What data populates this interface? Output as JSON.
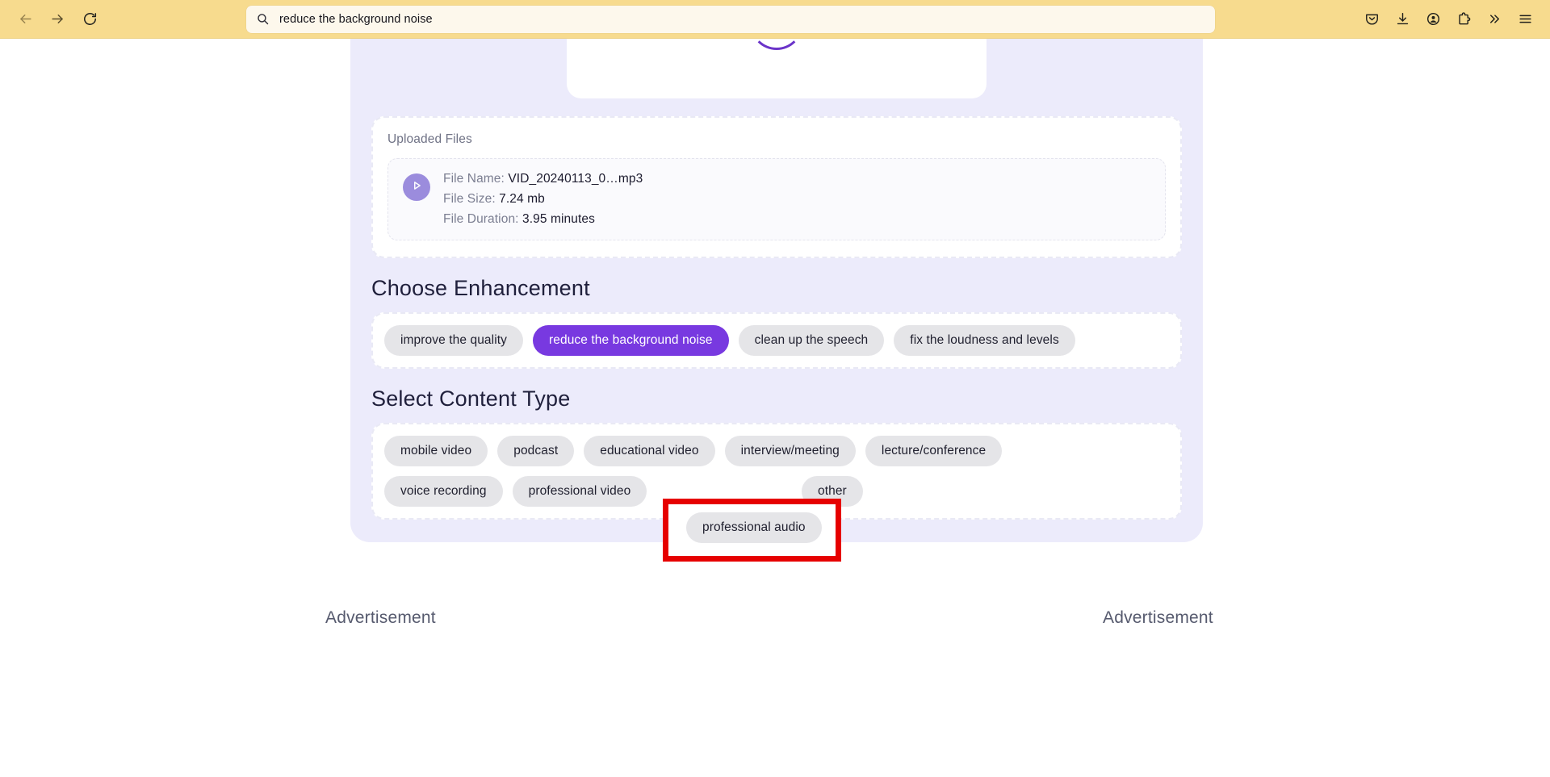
{
  "browser": {
    "back_icon": "back-arrow-icon",
    "forward_icon": "forward-arrow-icon",
    "reload_icon": "reload-icon",
    "urlbar": {
      "search_icon": "search-icon",
      "value": "reduce the background noise",
      "placeholder": "Search with Google or enter address"
    },
    "right_icons": [
      {
        "name": "pocket-save-icon",
        "label": "Save to Pocket"
      },
      {
        "name": "downloads-icon",
        "label": "Downloads"
      },
      {
        "name": "account-icon",
        "label": "Account"
      },
      {
        "name": "extensions-icon",
        "label": "Extensions"
      },
      {
        "name": "overflow-chevrons-icon",
        "label": "More tools"
      },
      {
        "name": "hamburger-menu-icon",
        "label": "Open application menu"
      }
    ]
  },
  "app": {
    "uploaded_files": {
      "panel_label": "Uploaded Files",
      "play_icon": "play-icon",
      "file": {
        "name_key": "File Name:",
        "name_value": "VID_20240113_0…mp3",
        "size_key": "File Size:",
        "size_value": "7.24 mb",
        "duration_key": "File Duration:",
        "duration_value": "3.95 minutes"
      }
    },
    "enhancement": {
      "title": "Choose Enhancement",
      "options": [
        {
          "label": "improve the quality",
          "selected": false
        },
        {
          "label": "reduce the background noise",
          "selected": true
        },
        {
          "label": "clean up the speech",
          "selected": false
        },
        {
          "label": "fix the loudness and levels",
          "selected": false
        }
      ]
    },
    "content_type": {
      "title": "Select Content Type",
      "row1": [
        {
          "label": "mobile video",
          "selected": false
        },
        {
          "label": "podcast",
          "selected": false
        },
        {
          "label": "educational video",
          "selected": false
        },
        {
          "label": "interview/meeting",
          "selected": false
        },
        {
          "label": "lecture/conference",
          "selected": false
        }
      ],
      "row2": [
        {
          "label": "voice recording",
          "selected": false
        },
        {
          "label": "professional video",
          "selected": false
        },
        {
          "label": "professional audio",
          "selected": false,
          "highlighted": true
        },
        {
          "label": "other",
          "selected": false
        }
      ]
    }
  },
  "ads": {
    "left_label": "Advertisement",
    "right_label": "Advertisement"
  },
  "colors": {
    "toolbar_bg": "#f7db8e",
    "urlbar_bg": "#fdf8ec",
    "app_bg": "#ecebfb",
    "accent_purple": "#7839e0",
    "chip_bg": "#e5e5e8",
    "annotation_red": "#e60000",
    "play_circle": "#9b8cdd"
  }
}
